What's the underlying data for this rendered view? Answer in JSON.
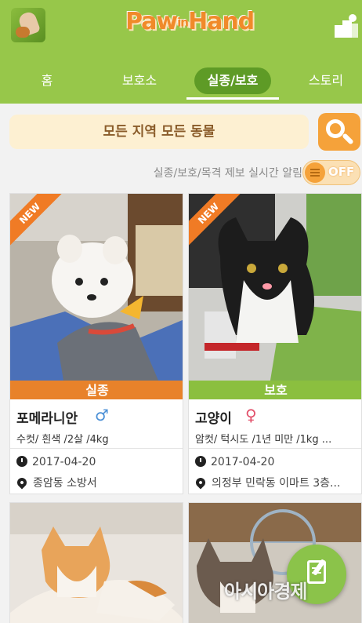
{
  "app": {
    "logo_text_left": "Paw",
    "logo_text_mid": "in",
    "logo_text_right": "Hand"
  },
  "tabs": [
    {
      "label": "홈",
      "active": false
    },
    {
      "label": "보호소",
      "active": false
    },
    {
      "label": "실종/보호",
      "active": true
    },
    {
      "label": "스토리",
      "active": false
    }
  ],
  "filter": {
    "label": "모든 지역  모든 동물"
  },
  "alert": {
    "label": "실종/보호/목격 제보 실시간 알림",
    "toggle_state": "OFF"
  },
  "cards": [
    {
      "badge": "NEW",
      "status": "실종",
      "breed": "포메라니안",
      "gender_symbol": "♂",
      "description": "수컷/ 흰색 /2살 /4kg",
      "date": "2017-04-20",
      "location": "종암동 소방서"
    },
    {
      "badge": "NEW",
      "status": "보호",
      "breed": "고양이",
      "gender_symbol": "♀",
      "description": "암컷/ 턱시도 /1년 미만 /1kg ...",
      "date": "2017-04-20",
      "location": "의정부 민락동 이마트 3층..."
    }
  ],
  "watermark": "아시아경제",
  "colors": {
    "brand_green": "#97c74a",
    "accent_orange": "#f5a23a",
    "missing_orange": "#e8822a",
    "protect_green": "#8bbf3f"
  }
}
